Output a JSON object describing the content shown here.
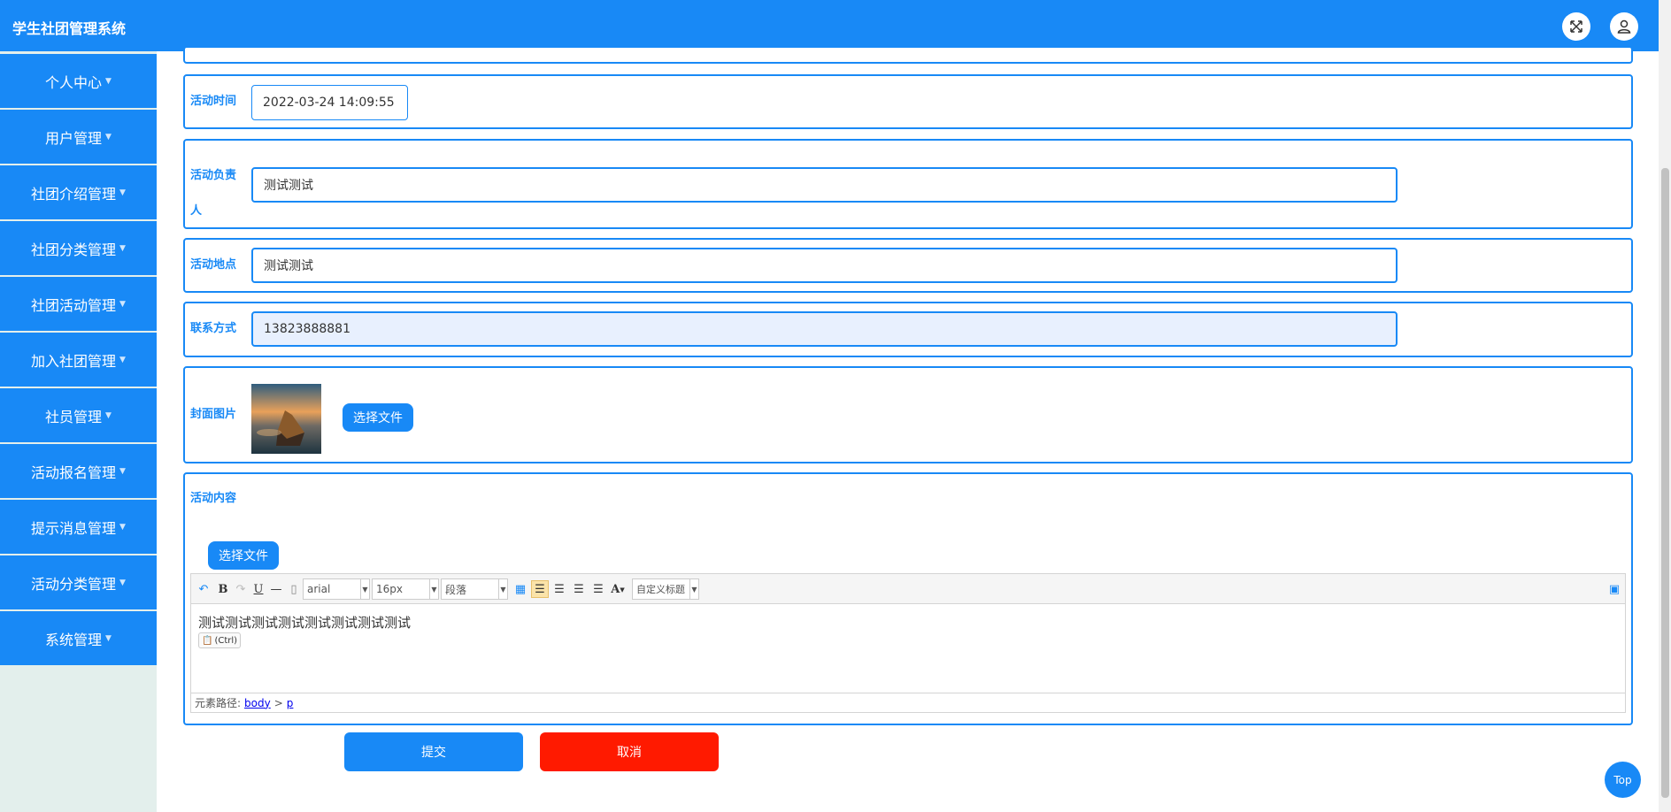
{
  "app": {
    "title": "学生社团管理系统"
  },
  "sidebar": {
    "items": [
      {
        "label": "个人中心"
      },
      {
        "label": "用户管理"
      },
      {
        "label": "社团介绍管理"
      },
      {
        "label": "社团分类管理"
      },
      {
        "label": "社团活动管理"
      },
      {
        "label": "加入社团管理"
      },
      {
        "label": "社员管理"
      },
      {
        "label": "活动报名管理"
      },
      {
        "label": "提示消息管理"
      },
      {
        "label": "活动分类管理"
      },
      {
        "label": "系统管理"
      }
    ]
  },
  "form": {
    "activity_time": {
      "label": "活动时间",
      "value": "2022-03-24 14:09:55"
    },
    "leader": {
      "label": "活动负责人",
      "value": "测试测试"
    },
    "location": {
      "label": "活动地点",
      "value": "测试测试"
    },
    "contact": {
      "label": "联系方式",
      "value": "13823888881"
    },
    "cover": {
      "label": "封面图片",
      "button": "选择文件"
    },
    "content": {
      "label": "活动内容",
      "upload_button": "选择文件",
      "toolbar": {
        "font_family": "arial",
        "font_size": "16px",
        "paragraph": "段落",
        "custom_heading": "自定义标题"
      },
      "body_text": "测试测试测试测试测试测试测试测试",
      "paste_hint": "(Ctrl)",
      "path_label": "元素路径:",
      "path_body": "body",
      "path_sep": ">",
      "path_p": "p"
    },
    "submit": "提交",
    "cancel": "取消"
  },
  "top_button": "Top",
  "colors": {
    "primary": "#1889f6",
    "danger": "#ff1a00",
    "sidebar_bg": "#e3efec",
    "readonly_bg": "#e8f0fe"
  }
}
